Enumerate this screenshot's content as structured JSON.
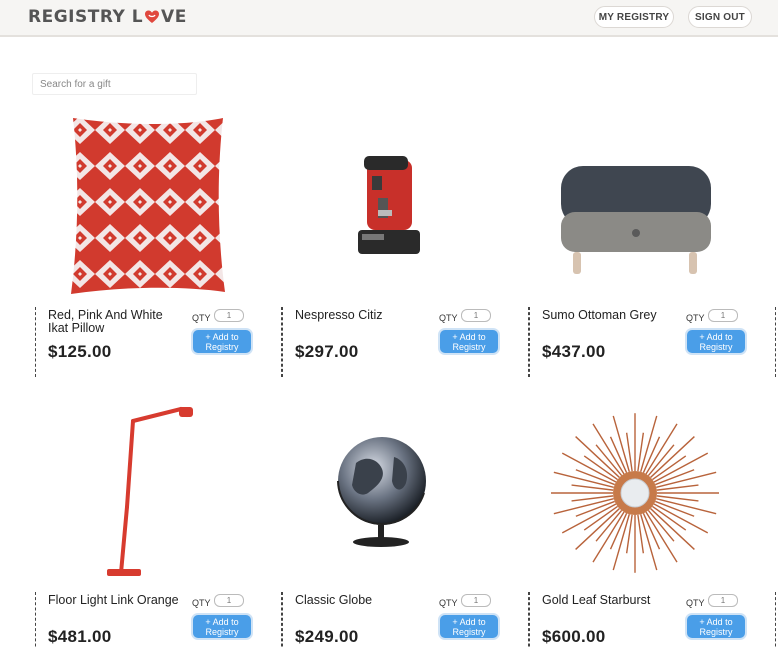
{
  "header": {
    "logo_prefix": "REGISTRY L",
    "logo_suffix": "VE",
    "my_registry": "MY REGISTRY",
    "sign_out": "SIGN OUT"
  },
  "search": {
    "placeholder": "Search for a gift"
  },
  "products": [
    {
      "name": "Red, Pink And White Ikat Pillow",
      "price": "$125.00",
      "qty_label": "QTY",
      "qty_value": "1",
      "button": "+ Add to Registry"
    },
    {
      "name": "Nespresso Citiz",
      "price": "$297.00",
      "qty_label": "QTY",
      "qty_value": "1",
      "button": "+ Add to Registry"
    },
    {
      "name": "Sumo Ottoman Grey",
      "price": "$437.00",
      "qty_label": "QTY",
      "qty_value": "1",
      "button": "+ Add to Registry"
    },
    {
      "name": "Floor Light Link Orange",
      "price": "$481.00",
      "qty_label": "QTY",
      "qty_value": "1",
      "button": "+ Add to Registry"
    },
    {
      "name": "Classic Globe",
      "price": "$249.00",
      "qty_label": "QTY",
      "qty_value": "1",
      "button": "+ Add to Registry"
    },
    {
      "name": "Gold Leaf Starburst",
      "price": "$600.00",
      "qty_label": "QTY",
      "qty_value": "1",
      "button": "+ Add to Registry"
    }
  ],
  "colors": {
    "accent": "#4a9ee8",
    "heart": "#e0483e",
    "header_bg": "#f6f5f3"
  }
}
